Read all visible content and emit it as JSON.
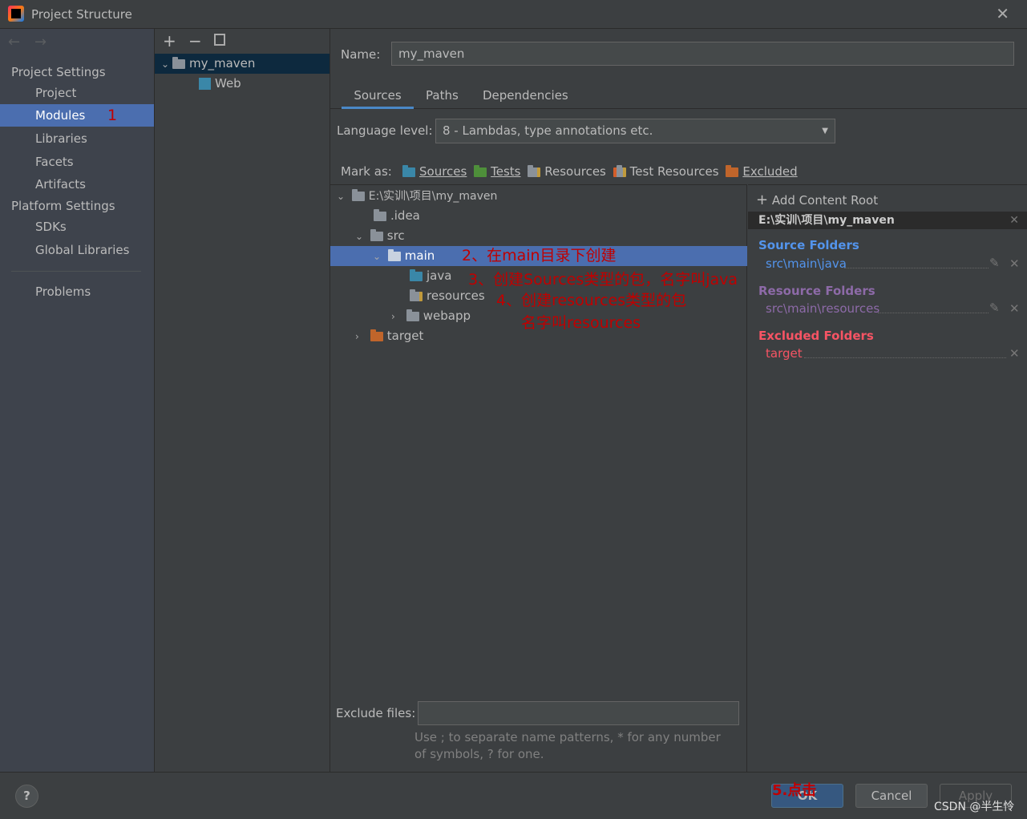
{
  "window": {
    "title": "Project Structure",
    "close_icon": "close-icon"
  },
  "sidebar": {
    "project_settings": "Project Settings",
    "items": [
      {
        "label": "Project"
      },
      {
        "label": "Modules"
      },
      {
        "label": "Libraries"
      },
      {
        "label": "Facets"
      },
      {
        "label": "Artifacts"
      }
    ],
    "platform_settings": "Platform Settings",
    "platform_items": [
      {
        "label": "SDKs"
      },
      {
        "label": "Global Libraries"
      }
    ],
    "problems": "Problems"
  },
  "modules": {
    "root": "my_maven",
    "child": "Web"
  },
  "main": {
    "name_label": "Name:",
    "name_value": "my_maven",
    "tabs": [
      {
        "label": "Sources"
      },
      {
        "label": "Paths"
      },
      {
        "label": "Dependencies"
      }
    ],
    "language_label": "Language level:",
    "language_value": "8 - Lambdas, type annotations etc.",
    "mark_as": "Mark as:",
    "marks": [
      {
        "label": "Sources",
        "color": "#3a87a8"
      },
      {
        "label": "Tests",
        "color": "#4e8f3a"
      },
      {
        "label": "Resources",
        "color": "#8a9199"
      },
      {
        "label": "Test Resources",
        "color": "#8a9199"
      },
      {
        "label": "Excluded",
        "color": "#c0652b"
      }
    ],
    "tree": [
      {
        "label": "E:\\实训\\项目\\my_maven"
      },
      {
        "label": ".idea"
      },
      {
        "label": "src"
      },
      {
        "label": "main"
      },
      {
        "label": "java"
      },
      {
        "label": "resources"
      },
      {
        "label": "webapp"
      },
      {
        "label": "target"
      }
    ],
    "exclude_label": "Exclude files:",
    "exclude_value": "",
    "exclude_hint": "Use ; to separate name patterns, * for any number of symbols, ? for one."
  },
  "roots": {
    "add": "Add Content Root",
    "path": "E:\\实训\\项目\\my_maven",
    "source_title": "Source Folders",
    "source_item": "src\\main\\java",
    "resource_title": "Resource Folders",
    "resource_item": "src\\main\\resources",
    "excluded_title": "Excluded Folders",
    "excluded_item": "target",
    "colors": {
      "source": "#5394ec",
      "resource": "#8d6aa8",
      "excluded": "#f75464"
    }
  },
  "annotations": {
    "a1": "1",
    "a2": "2、在main目录下创建",
    "a3": "3、创建Sources类型的包，名字叫java",
    "a4": "4、创建resources类型的包",
    "a4b": "名字叫resources",
    "a5": "5.点击"
  },
  "footer": {
    "help": "?",
    "ok": "OK",
    "cancel": "Cancel",
    "apply": "Apply",
    "watermark": "CSDN @半生怜"
  }
}
